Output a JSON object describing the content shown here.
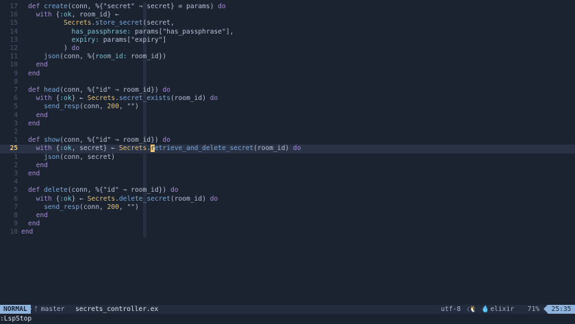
{
  "editor": {
    "lines": [
      {
        "num": "17",
        "tokens": [
          [
            "kw",
            "def "
          ],
          [
            "fn",
            "create"
          ],
          [
            "plain",
            "(conn, %{"
          ],
          [
            "str",
            "\"secret\""
          ],
          [
            "plain",
            " ⇒ secret} = params) "
          ],
          [
            "kw",
            "do"
          ]
        ]
      },
      {
        "num": "16",
        "tokens": [
          [
            "plain",
            "  "
          ],
          [
            "kw",
            "with "
          ],
          [
            "plain",
            "{"
          ],
          [
            "atom",
            ":ok"
          ],
          [
            "plain",
            ", room_id} ← "
          ]
        ]
      },
      {
        "num": "15",
        "tokens": [
          [
            "plain",
            "         "
          ],
          [
            "mod",
            "Secrets"
          ],
          [
            "plain",
            "."
          ],
          [
            "fn",
            "store_secret"
          ],
          [
            "plain",
            "(secret,"
          ]
        ]
      },
      {
        "num": "14",
        "tokens": [
          [
            "plain",
            "           "
          ],
          [
            "key",
            "has_passphrase: "
          ],
          [
            "plain",
            "params["
          ],
          [
            "str",
            "\"has_passphrase\""
          ],
          [
            "plain",
            "],"
          ]
        ]
      },
      {
        "num": "13",
        "tokens": [
          [
            "plain",
            "           "
          ],
          [
            "key",
            "expiry: "
          ],
          [
            "plain",
            "params["
          ],
          [
            "str",
            "\"expiry\""
          ],
          [
            "plain",
            "]"
          ]
        ]
      },
      {
        "num": "12",
        "tokens": [
          [
            "plain",
            "         ) "
          ],
          [
            "kw",
            "do"
          ]
        ]
      },
      {
        "num": "11",
        "tokens": [
          [
            "plain",
            "    "
          ],
          [
            "fn",
            "json"
          ],
          [
            "plain",
            "(conn, %{"
          ],
          [
            "key",
            "room_id: "
          ],
          [
            "plain",
            "room_id})"
          ]
        ]
      },
      {
        "num": "10",
        "tokens": [
          [
            "plain",
            "  "
          ],
          [
            "kw",
            "end"
          ]
        ]
      },
      {
        "num": "9",
        "tokens": [
          [
            "kw",
            "end"
          ]
        ]
      },
      {
        "num": "8",
        "tokens": []
      },
      {
        "num": "7",
        "tokens": [
          [
            "kw",
            "def "
          ],
          [
            "fn",
            "head"
          ],
          [
            "plain",
            "(conn, %{"
          ],
          [
            "str",
            "\"id\""
          ],
          [
            "plain",
            " ⇒ room_id}) "
          ],
          [
            "kw",
            "do"
          ]
        ]
      },
      {
        "num": "6",
        "tokens": [
          [
            "plain",
            "  "
          ],
          [
            "kw",
            "with "
          ],
          [
            "plain",
            "{"
          ],
          [
            "atom",
            ":ok"
          ],
          [
            "plain",
            "} ← "
          ],
          [
            "mod",
            "Secrets"
          ],
          [
            "plain",
            "."
          ],
          [
            "fn",
            "secret_exists"
          ],
          [
            "plain",
            "(room_id) "
          ],
          [
            "kw",
            "do"
          ]
        ]
      },
      {
        "num": "5",
        "tokens": [
          [
            "plain",
            "    "
          ],
          [
            "fn",
            "send_resp"
          ],
          [
            "plain",
            "(conn, "
          ],
          [
            "num",
            "200"
          ],
          [
            "plain",
            ", "
          ],
          [
            "str",
            "\"\""
          ],
          [
            "plain",
            ")"
          ]
        ]
      },
      {
        "num": "4",
        "tokens": [
          [
            "plain",
            "  "
          ],
          [
            "kw",
            "end"
          ]
        ]
      },
      {
        "num": "3",
        "tokens": [
          [
            "kw",
            "end"
          ]
        ]
      },
      {
        "num": "2",
        "tokens": []
      },
      {
        "num": "1",
        "tokens": [
          [
            "kw",
            "def "
          ],
          [
            "fn",
            "show"
          ],
          [
            "plain",
            "(conn, %{"
          ],
          [
            "str",
            "\"id\""
          ],
          [
            "plain",
            " ⇒ room_id}) "
          ],
          [
            "kw",
            "do"
          ]
        ]
      },
      {
        "num": "25",
        "current": true,
        "tokens": [
          [
            "plain",
            "  "
          ],
          [
            "kw",
            "with "
          ],
          [
            "plain",
            "{"
          ],
          [
            "atom",
            ":ok"
          ],
          [
            "plain",
            ", secret} ← "
          ],
          [
            "mod",
            "Secrets"
          ],
          [
            "plain",
            "."
          ],
          [
            "cursor",
            "r"
          ],
          [
            "fn",
            "etrieve_and_delete_secret"
          ],
          [
            "plain",
            "(room_id) "
          ],
          [
            "kw",
            "do"
          ]
        ]
      },
      {
        "num": "1",
        "tokens": [
          [
            "plain",
            "    "
          ],
          [
            "fn",
            "json"
          ],
          [
            "plain",
            "(conn, secret)"
          ]
        ]
      },
      {
        "num": "2",
        "tokens": [
          [
            "plain",
            "  "
          ],
          [
            "kw",
            "end"
          ]
        ]
      },
      {
        "num": "3",
        "tokens": [
          [
            "kw",
            "end"
          ]
        ]
      },
      {
        "num": "4",
        "tokens": []
      },
      {
        "num": "5",
        "tokens": [
          [
            "kw",
            "def "
          ],
          [
            "fn",
            "delete"
          ],
          [
            "plain",
            "(conn, %{"
          ],
          [
            "str",
            "\"id\""
          ],
          [
            "plain",
            " ⇒ room_id}) "
          ],
          [
            "kw",
            "do"
          ]
        ]
      },
      {
        "num": "6",
        "tokens": [
          [
            "plain",
            "  "
          ],
          [
            "kw",
            "with "
          ],
          [
            "plain",
            "{"
          ],
          [
            "atom",
            ":ok"
          ],
          [
            "plain",
            "} ← "
          ],
          [
            "mod",
            "Secrets"
          ],
          [
            "plain",
            "."
          ],
          [
            "fn",
            "delete_secret"
          ],
          [
            "plain",
            "(room_id) "
          ],
          [
            "kw",
            "do"
          ]
        ]
      },
      {
        "num": "7",
        "tokens": [
          [
            "plain",
            "    "
          ],
          [
            "fn",
            "send_resp"
          ],
          [
            "plain",
            "(conn, "
          ],
          [
            "num",
            "200"
          ],
          [
            "plain",
            ", "
          ],
          [
            "str",
            "\"\""
          ],
          [
            "plain",
            ")"
          ]
        ]
      },
      {
        "num": "8",
        "tokens": [
          [
            "plain",
            "  "
          ],
          [
            "kw",
            "end"
          ]
        ]
      },
      {
        "num": "9",
        "tokens": [
          [
            "kw",
            "end"
          ]
        ]
      },
      {
        "num": "10",
        "tokens": [
          [
            "kw",
            "end"
          ]
        ],
        "outdent": true
      }
    ]
  },
  "statusbar": {
    "mode": "NORMAL",
    "branch_icon": "git-branch-icon",
    "branch": "master",
    "filename": "secrets_controller.ex",
    "encoding": "utf-8",
    "os_icon": "linux-penguin-icon",
    "filetype_icon": "elixir-drop-icon",
    "filetype": "elixir",
    "percent": "71%",
    "position": "25:35"
  },
  "cmdline": {
    "text": ":LspStop"
  },
  "colors": {
    "background": "#1b2331",
    "mode_bg": "#8fb3dc",
    "current_line_nr": "#f0c674"
  }
}
